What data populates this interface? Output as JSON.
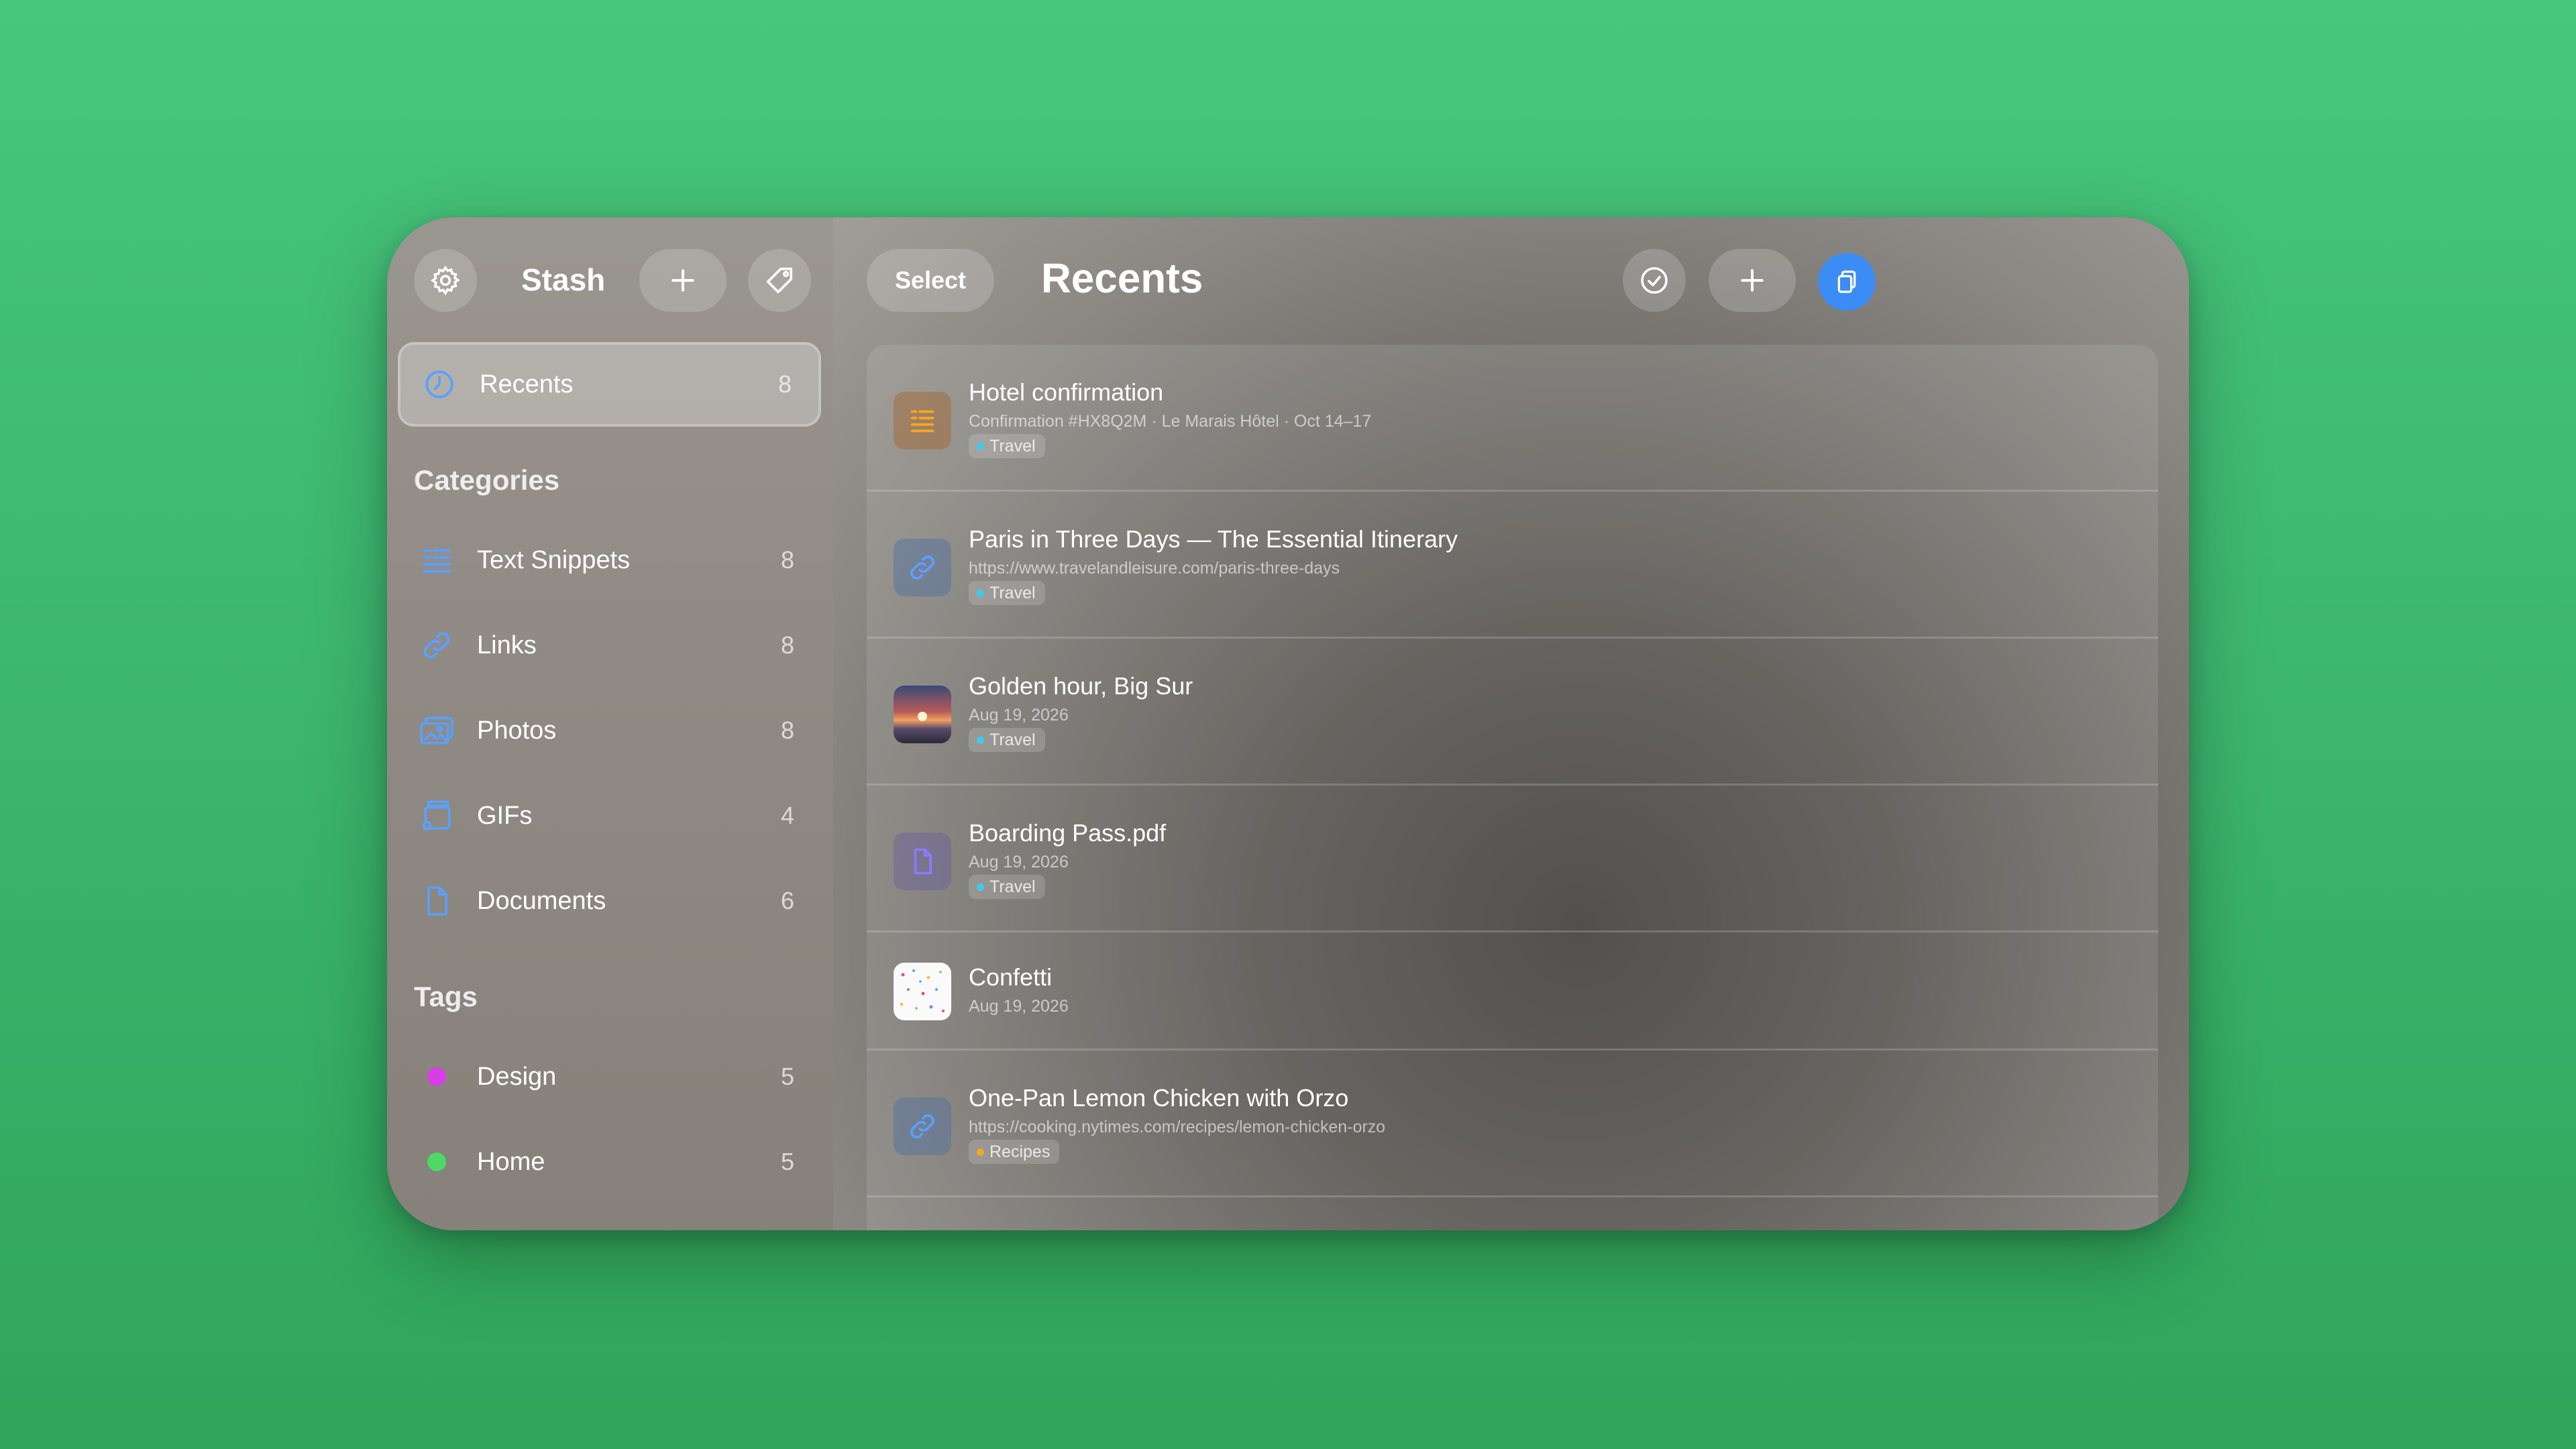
{
  "sidebar": {
    "title": "Stash",
    "recents": {
      "label": "Recents",
      "count": "8"
    },
    "categories_title": "Categories",
    "categories": [
      {
        "label": "Text Snippets",
        "count": "8",
        "icon": "text-snippet-icon"
      },
      {
        "label": "Links",
        "count": "8",
        "icon": "link-icon"
      },
      {
        "label": "Photos",
        "count": "8",
        "icon": "photos-icon"
      },
      {
        "label": "GIFs",
        "count": "4",
        "icon": "gif-icon"
      },
      {
        "label": "Documents",
        "count": "6",
        "icon": "document-icon"
      }
    ],
    "tags_title": "Tags",
    "tags": [
      {
        "label": "Design",
        "count": "5",
        "color": "#d93ee6"
      },
      {
        "label": "Home",
        "count": "5",
        "color": "#4cd964"
      }
    ]
  },
  "main": {
    "select_label": "Select",
    "title": "Recents",
    "items": [
      {
        "title": "Hotel confirmation",
        "subtitle": "Confirmation #HX8Q2M · Le Marais Hôtel · Oct 14–17",
        "tag": "Travel",
        "tag_color": "#3ec9f0",
        "icon": "text-snippet-icon"
      },
      {
        "title": "Paris in Three Days — The Essential Itinerary",
        "subtitle": "https://www.travelandleisure.com/paris-three-days",
        "tag": "Travel",
        "tag_color": "#3ec9f0",
        "icon": "link-icon"
      },
      {
        "title": "Golden hour, Big Sur",
        "subtitle": "Aug 19, 2026",
        "tag": "Travel",
        "tag_color": "#3ec9f0",
        "icon": "photo-thumbnail"
      },
      {
        "title": "Boarding Pass.pdf",
        "subtitle": "Aug 19, 2026",
        "tag": "Travel",
        "tag_color": "#3ec9f0",
        "icon": "document-icon"
      },
      {
        "title": "Confetti",
        "subtitle": "Aug 19, 2026",
        "icon": "gif-thumbnail"
      },
      {
        "title": "One-Pan Lemon Chicken with Orzo",
        "subtitle": "https://cooking.nytimes.com/recipes/lemon-chicken-orzo",
        "tag": "Recipes",
        "tag_color": "#f5a623",
        "icon": "link-icon"
      }
    ]
  },
  "colors": {
    "accent": "#3b8cf5",
    "link_icon": "#5aa0ff",
    "doc_icon": "#8c7bff",
    "snippet_icon": "#f5a623"
  }
}
